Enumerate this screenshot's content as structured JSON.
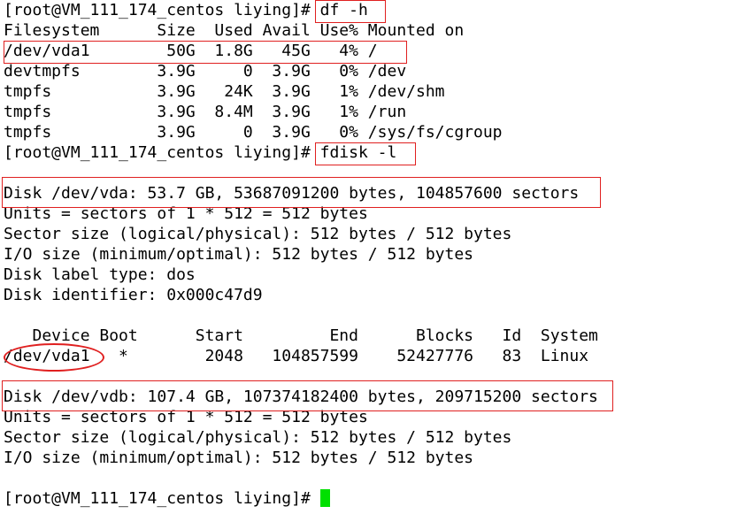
{
  "colors": {
    "background": "#ffffff",
    "text": "#000000",
    "annotation": "#e02020",
    "cursor": "#00e000"
  },
  "terminal": {
    "lines": [
      "[root@VM_111_174_centos liying]# df -h",
      "Filesystem      Size  Used Avail Use% Mounted on",
      "/dev/vda1        50G  1.8G   45G   4% /",
      "devtmpfs        3.9G     0  3.9G   0% /dev",
      "tmpfs           3.9G   24K  3.9G   1% /dev/shm",
      "tmpfs           3.9G  8.4M  3.9G   1% /run",
      "tmpfs           3.9G     0  3.9G   0% /sys/fs/cgroup",
      "[root@VM_111_174_centos liying]# fdisk -l",
      "",
      "Disk /dev/vda: 53.7 GB, 53687091200 bytes, 104857600 sectors",
      "Units = sectors of 1 * 512 = 512 bytes",
      "Sector size (logical/physical): 512 bytes / 512 bytes",
      "I/O size (minimum/optimal): 512 bytes / 512 bytes",
      "Disk label type: dos",
      "Disk identifier: 0x000c47d9",
      "",
      "   Device Boot      Start         End      Blocks   Id  System",
      "/dev/vda1   *        2048   104857599    52427776   83  Linux",
      "",
      "Disk /dev/vdb: 107.4 GB, 107374182400 bytes, 209715200 sectors",
      "Units = sectors of 1 * 512 = 512 bytes",
      "Sector size (logical/physical): 512 bytes / 512 bytes",
      "I/O size (minimum/optimal): 512 bytes / 512 bytes",
      "",
      "[root@VM_111_174_centos liying]# "
    ]
  }
}
